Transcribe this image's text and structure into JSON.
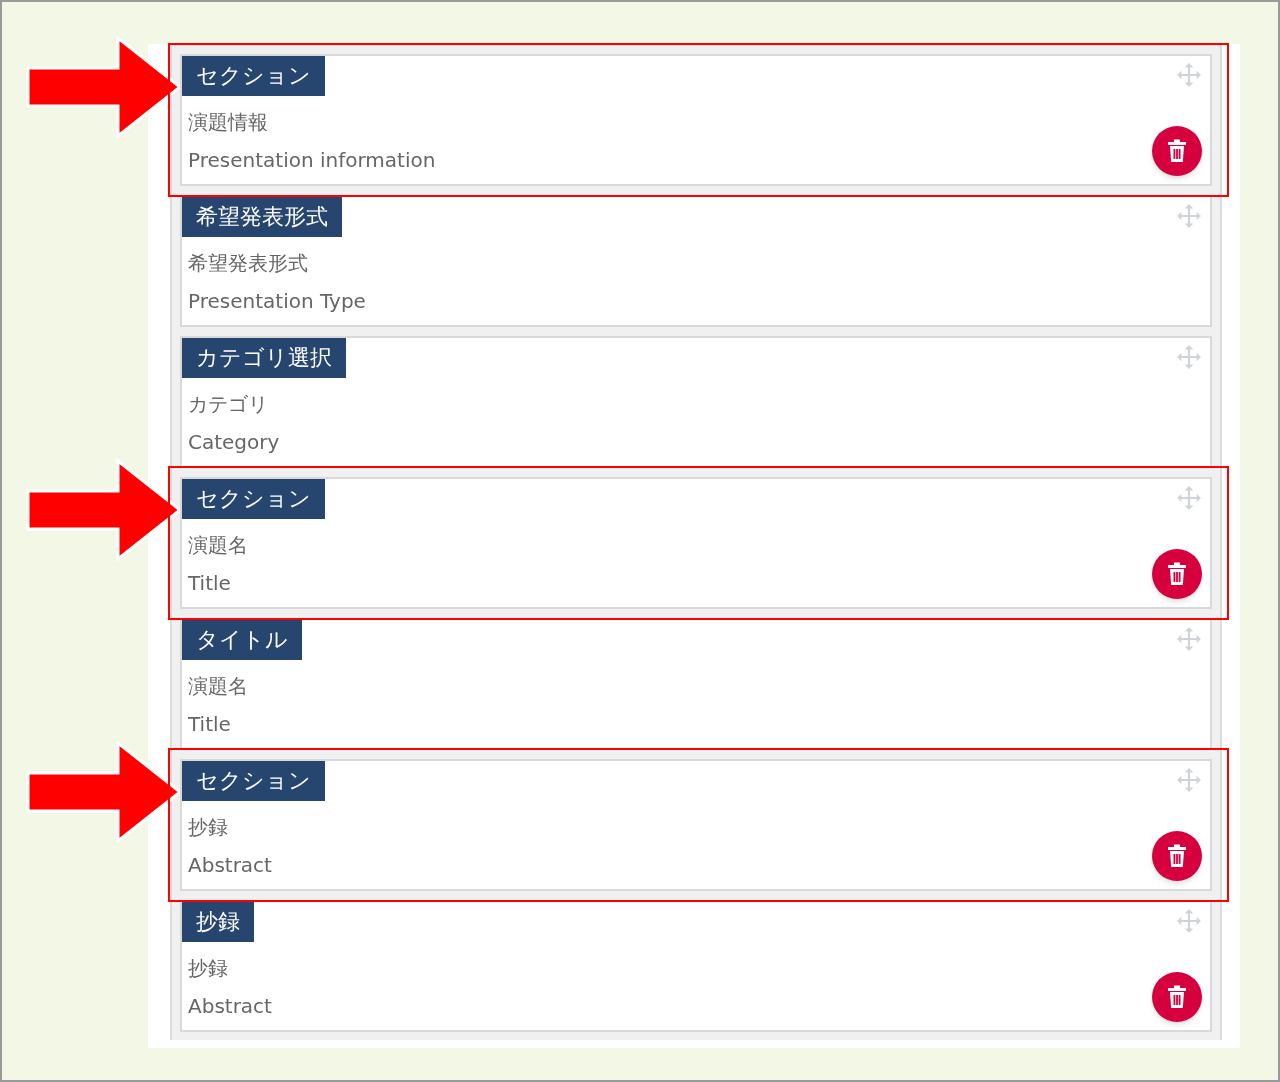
{
  "items": [
    {
      "tag": "セクション",
      "label_ja": "演題情報",
      "label_en": "Presentation information",
      "deletable": true,
      "highlighted": true
    },
    {
      "tag": "希望発表形式",
      "label_ja": "希望発表形式",
      "label_en": "Presentation Type",
      "deletable": false,
      "highlighted": false
    },
    {
      "tag": "カテゴリ選択",
      "label_ja": "カテゴリ",
      "label_en": "Category",
      "deletable": false,
      "highlighted": false
    },
    {
      "tag": "セクション",
      "label_ja": "演題名",
      "label_en": "Title",
      "deletable": true,
      "highlighted": true
    },
    {
      "tag": "タイトル",
      "label_ja": "演題名",
      "label_en": "Title",
      "deletable": false,
      "highlighted": false
    },
    {
      "tag": "セクション",
      "label_ja": "抄録",
      "label_en": "Abstract",
      "deletable": true,
      "highlighted": true
    },
    {
      "tag": "抄録",
      "label_ja": "抄録",
      "label_en": "Abstract",
      "deletable": true,
      "highlighted": false
    }
  ]
}
